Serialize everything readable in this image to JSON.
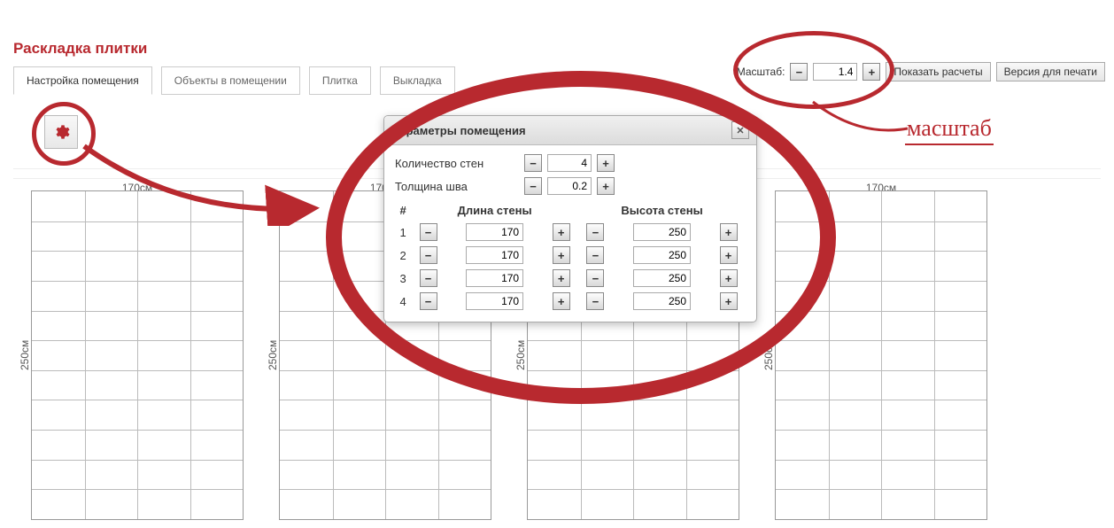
{
  "title": "Раскладка плитки",
  "tabs": [
    "Настройка помещения",
    "Объекты в помещении",
    "Плитка",
    "Выкладка"
  ],
  "activeTab": 0,
  "toolbar": {
    "scale_label": "Масштаб:",
    "scale_value": "1.4",
    "show_calc": "Показать расчеты",
    "print": "Версия для печати"
  },
  "annotation": {
    "scale_text": "масштаб"
  },
  "dialog": {
    "title": "Параметры помещения",
    "walls_count_label": "Количество стен",
    "walls_count_value": "4",
    "seam_label": "Толщина шва",
    "seam_value": "0.2",
    "col_num": "#",
    "col_len": "Длина стены",
    "col_height": "Высота стены",
    "rows": [
      {
        "n": "1",
        "len": "170",
        "h": "250"
      },
      {
        "n": "2",
        "len": "170",
        "h": "250"
      },
      {
        "n": "3",
        "len": "170",
        "h": "250"
      },
      {
        "n": "4",
        "len": "170",
        "h": "250"
      }
    ]
  },
  "walls": {
    "width_label": "170см",
    "height_label": "250см"
  }
}
